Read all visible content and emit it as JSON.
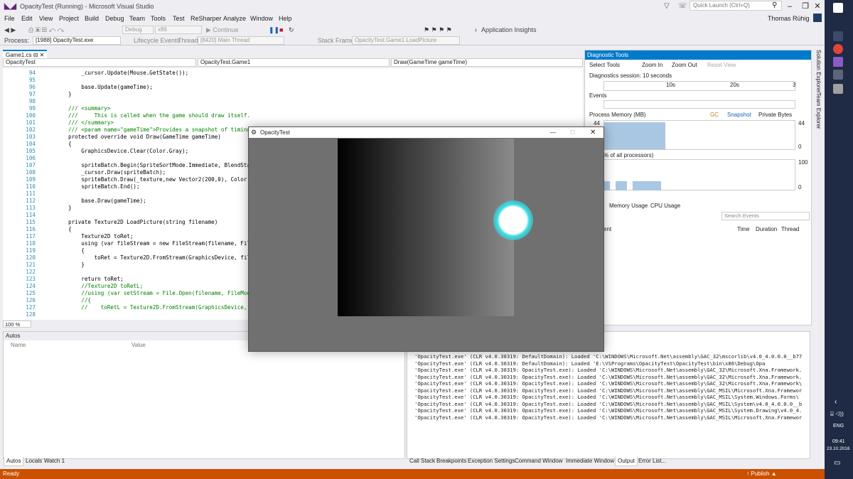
{
  "window": {
    "title": "OpacityTest (Running) - Microsoft Visual Studio",
    "quick_launch_placeholder": "Quick Launch (Ctrl+Q)",
    "user": "Thomas Rühig"
  },
  "menu": [
    "File",
    "Edit",
    "View",
    "Project",
    "Build",
    "Debug",
    "Team",
    "Tools",
    "Test",
    "ReSharper",
    "Analyze",
    "Window",
    "Help"
  ],
  "toolbar": {
    "config": "Debug",
    "platform": "x86",
    "continue_label": "Continue",
    "app_insights": "Application Insights",
    "process_label": "Process:",
    "process_value": "[1988] OpacityTest.exe",
    "lifecycle_label": "Lifecycle Events",
    "thread_label": "Thread:",
    "thread_value": "[8420] Main Thread",
    "stack_label": "Stack Frame:",
    "stack_value": "OpacityTest.Game1.LoadPicture"
  },
  "editor": {
    "tab": "Game1.cs",
    "nav_left": "OpacityTest",
    "nav_mid": "OpacityTest.Game1",
    "nav_right": "Draw(GameTime gameTime)",
    "zoom": "100 %",
    "lines": [
      {
        "n": "94",
        "t": "    _cursor.Update(Mouse.GetState());"
      },
      {
        "n": "95",
        "t": ""
      },
      {
        "n": "96",
        "t": "    base.Update(gameTime);"
      },
      {
        "n": "97",
        "t": "}"
      },
      {
        "n": "98",
        "t": ""
      },
      {
        "n": "99",
        "t": "/// <summary>"
      },
      {
        "n": "100",
        "t": "///     This is called when the game should draw itself."
      },
      {
        "n": "101",
        "t": "/// </summary>"
      },
      {
        "n": "102",
        "t": "/// <param name=\"gameTime\">Provides a snapshot of timing v"
      },
      {
        "n": "103",
        "t": "protected override void Draw(GameTime gameTime)"
      },
      {
        "n": "104",
        "t": "{"
      },
      {
        "n": "105",
        "t": "    GraphicsDevice.Clear(Color.Gray);"
      },
      {
        "n": "106",
        "t": ""
      },
      {
        "n": "107",
        "t": "    spriteBatch.Begin(SpriteSortMode.Immediate, BlendState"
      },
      {
        "n": "108",
        "t": "    _cursor.Draw(spriteBatch);"
      },
      {
        "n": "109",
        "t": "    spriteBatch.Draw(_texture,new Vector2(200,0), Color.Wh"
      },
      {
        "n": "110",
        "t": "    spriteBatch.End();"
      },
      {
        "n": "111",
        "t": ""
      },
      {
        "n": "112",
        "t": "    base.Draw(gameTime);"
      },
      {
        "n": "113",
        "t": "}"
      },
      {
        "n": "114",
        "t": ""
      },
      {
        "n": "115",
        "t": "private Texture2D LoadPicture(string filename)"
      },
      {
        "n": "116",
        "t": "{"
      },
      {
        "n": "117",
        "t": "    Texture2D toRet;"
      },
      {
        "n": "118",
        "t": "    using (var fileStream = new FileStream(filename, FileM"
      },
      {
        "n": "119",
        "t": "    {"
      },
      {
        "n": "120",
        "t": "        toRet = Texture2D.FromStream(GraphicsDevice, fileS"
      },
      {
        "n": "121",
        "t": "    }"
      },
      {
        "n": "122",
        "t": ""
      },
      {
        "n": "123",
        "t": "    return toRet;"
      },
      {
        "n": "124",
        "t": "    //Texture2D toRetL;"
      },
      {
        "n": "125",
        "t": "    //using (var setStream = File.Open(filename, FileMode."
      },
      {
        "n": "126",
        "t": "    //{"
      },
      {
        "n": "127",
        "t": "    //    toRetL = Texture2D.FromStream(GraphicsDevice, se"
      },
      {
        "n": "128",
        "t": ""
      }
    ]
  },
  "diagnostics": {
    "title": "Diagnostic Tools",
    "select_tools": "Select Tools",
    "zoom_in": "Zoom In",
    "zoom_out": "Zoom Out",
    "reset_view": "Reset View",
    "session": "Diagnostics session: 10 seconds",
    "tick_10": "10s",
    "tick_20": "20s",
    "tick_30": "3",
    "events": "Events",
    "process_memory": "Process Memory (MB)",
    "gc": "GC",
    "snapshot": "Snapshot",
    "private_bytes": "Private Bytes",
    "mem_max": "44",
    "mem_max_r": "44",
    "mem_min": "0",
    "cpu_label": "% of all processors)",
    "cpu_max": "100",
    "cpu_min": "0",
    "tab_memory": "Memory Usage",
    "tab_cpu": "CPU Usage",
    "search_events": "Search Events",
    "col_event": "ent",
    "col_time": "Time",
    "col_duration": "Duration",
    "col_thread": "Thread"
  },
  "autos": {
    "title": "Autos",
    "col_name": "Name",
    "col_value": "Value",
    "tabs": [
      "Autos",
      "Locals",
      "Watch 1"
    ]
  },
  "output": {
    "lines": [
      "'OpacityTest.exe' (CLR v4.0.30319: DefaultDomain): Loaded 'C:\\WINDOWS\\Microsoft.Net\\assembly\\GAC_32\\mscorlib\\v4.0_4.0.0.0__b77",
      "'OpacityTest.exe' (CLR v4.0.30319: DefaultDomain): Loaded 'E:\\VSPrograms\\OpacityTest\\OpacityTest\\bin\\x86\\Debug\\Opa",
      "'OpacityTest.exe' (CLR v4.0.30319: OpacityTest.exe): Loaded 'C:\\WINDOWS\\Microsoft.Net\\assembly\\GAC_32\\Microsoft.Xna.Framework.",
      "'OpacityTest.exe' (CLR v4.0.30319: OpacityTest.exe): Loaded 'C:\\WINDOWS\\Microsoft.Net\\assembly\\GAC_32\\Microsoft.Xna.Framework.",
      "'OpacityTest.exe' (CLR v4.0.30319: OpacityTest.exe): Loaded 'C:\\WINDOWS\\Microsoft.Net\\assembly\\GAC_32\\Microsoft.Xna.Framework\\",
      "'OpacityTest.exe' (CLR v4.0.30319: OpacityTest.exe): Loaded 'C:\\WINDOWS\\Microsoft.Net\\assembly\\GAC_MSIL\\Microsoft.Xna.Framewor",
      "'OpacityTest.exe' (CLR v4.0.30319: OpacityTest.exe): Loaded 'C:\\WINDOWS\\Microsoft.Net\\assembly\\GAC_MSIL\\System.Windows.Forms\\",
      "'OpacityTest.exe' (CLR v4.0.30319: OpacityTest.exe): Loaded 'C:\\WINDOWS\\Microsoft.Net\\assembly\\GAC_MSIL\\System\\v4.0_4.0.0.0__b",
      "'OpacityTest.exe' (CLR v4.0.30319: OpacityTest.exe): Loaded 'C:\\WINDOWS\\Microsoft.Net\\assembly\\GAC_MSIL\\System.Drawing\\v4.0_4.",
      "'OpacityTest.exe' (CLR v4.0.30319: OpacityTest.exe): Loaded 'C:\\WINDOWS\\Microsoft.Net\\assembly\\GAC_MSIL\\Microsoft.Xna.Framewor"
    ],
    "tabs": [
      "Call Stack",
      "Breakpoints",
      "Exception Settings",
      "Command Window",
      "Immediate Window",
      "Output",
      "Error List..."
    ]
  },
  "status": {
    "text": "Ready",
    "publish": "Publish"
  },
  "game_window": {
    "title": "OpacityTest"
  },
  "sidebar": {
    "solution_explorer": "Solution Explorer",
    "team_explorer": "Team Explorer"
  },
  "tray": {
    "lang": "ENG",
    "time": "09:41",
    "date": "23.10.2016"
  }
}
